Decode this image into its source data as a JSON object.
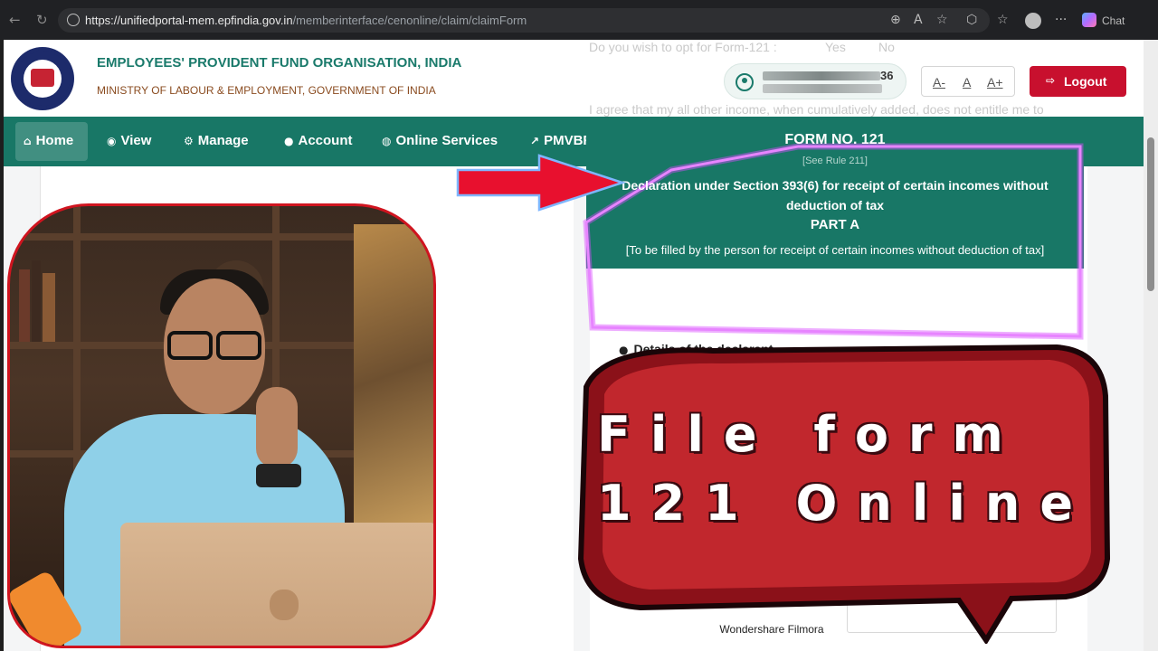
{
  "browser": {
    "url_host": "https://unifiedportal-mem.epfindia.gov.in",
    "url_path": "/memberinterface/cenonline/claim/claimForm",
    "chat_label": "Chat"
  },
  "header": {
    "org_title": "EMPLOYEES' PROVIDENT FUND ORGANISATION, INDIA",
    "ministry": "MINISTRY OF LABOUR & EMPLOYMENT, GOVERNMENT OF INDIA",
    "ghost_question": "Do you wish to opt for Form-121 :",
    "ghost_yes": "Yes",
    "ghost_no": "No",
    "ghost_agree": "I agree that my all other income, when cumulatively added, does not entitle me to",
    "user_suffix": "36",
    "font_small": "A-",
    "font_normal": "A",
    "font_large": "A+",
    "logout_label": "Logout"
  },
  "nav": {
    "items": [
      {
        "label": "Home",
        "icon": "home-icon"
      },
      {
        "label": "View",
        "icon": "eye-icon"
      },
      {
        "label": "Manage",
        "icon": "gears-icon"
      },
      {
        "label": "Account",
        "icon": "user-icon"
      },
      {
        "label": "Online Services",
        "icon": "globe-icon"
      },
      {
        "label": "PMVBRY",
        "icon": "chart-line-icon"
      }
    ]
  },
  "form": {
    "form_no": "FORM NO. 121",
    "see_rule": "[See Rule 211]",
    "declaration": "Declaration under Section 393(6) for receipt of certain incomes without deduction of tax",
    "part": "PART A",
    "to_fill": "[To be filled by the person for receipt of certain incomes without deduction of tax]",
    "details_heading": "Details of the declarant"
  },
  "overlay": {
    "bubble_line1": "File form",
    "bubble_line2": "121 Online",
    "watermark": "Wondershare Filmora",
    "arrow_color": "#e8102e",
    "neon_color": "#e040fb",
    "bubble_color": "#c1272d"
  }
}
